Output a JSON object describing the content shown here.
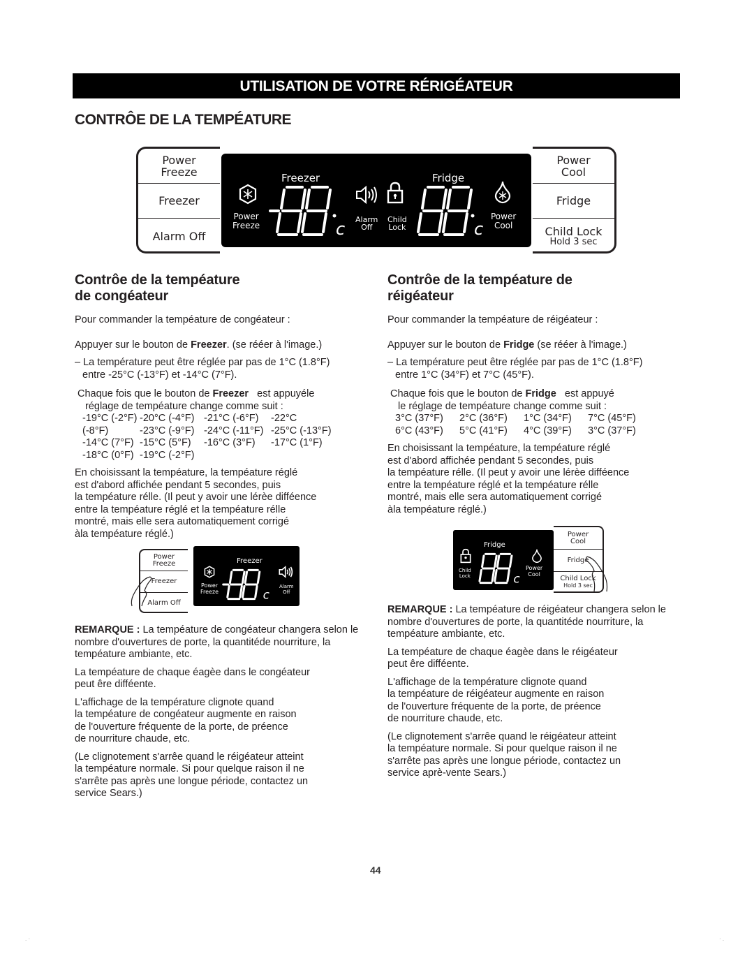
{
  "banner": "UTILISATION DE VOTRE RÉRIGÉATEUR",
  "section_title": "CONTRÔE DE LA TEMPÉATURE",
  "control_panel": {
    "left_buttons": [
      {
        "line1": "Power",
        "line2": "Freeze"
      },
      {
        "line1": "Freezer",
        "line2": ""
      },
      {
        "line1": "Alarm Off",
        "line2": ""
      }
    ],
    "right_buttons": [
      {
        "line1": "Power",
        "line2": "Cool"
      },
      {
        "line1": "Fridge",
        "line2": ""
      },
      {
        "line1": "Child Lock",
        "line2": "Hold 3 sec"
      }
    ],
    "display": {
      "freezer_label": "Freezer",
      "fridge_label": "Fridge",
      "power_freeze_l1": "Power",
      "power_freeze_l2": "Freeze",
      "alarm_off_l1": "Alarm",
      "alarm_off_l2": "Off",
      "child_lock_l1": "Child",
      "child_lock_l2": "Lock",
      "power_cool_l1": "Power",
      "power_cool_l2": "Cool",
      "freezer_readout": "-88",
      "fridge_readout": "88",
      "unit": "c",
      "icons": [
        "snowflake-hexagon-icon",
        "speaker-icon",
        "padlock-icon",
        "droplet-snowflake-icon"
      ]
    }
  },
  "freezer_section": {
    "heading_l1": "Contrôe de la tempéature",
    "heading_l2": "de congéateur",
    "intro": "Pour commander la tempéature de congéateur :",
    "press_pre": "Appuyer sur le bouton de ",
    "press_bold": "Freezer",
    "press_post": ". (se rééer à l'image.)",
    "range_l1": "– La température peut être réglée par pas de 1°C (1.8°F)",
    "range_l2": "entre -25°C (-13°F) et -14°C (7°F).",
    "each_pre": "Chaque fois que le bouton de ",
    "each_bold": "Freezer",
    "each_post": "   est appuyéle",
    "each_l2": "réglage de tempéature change comme suit :",
    "sequence": [
      "-19°C (-2°F)",
      "-20°C (-4°F)",
      "-21°C (-6°F)",
      "-22°C",
      "(-8°F)",
      "-23°C (-9°F)",
      "-24°C (-11°F)",
      "-25°C (-13°F)",
      "-14°C (7°F)",
      "-15°C (5°F)",
      "-16°C (3°F)",
      "-17°C (1°F)",
      "-18°C (0°F)",
      "-19°C (-2°F)"
    ],
    "choose": [
      "En choisissant la tempéature, la tempéature réglé",
      "est d'abord affichée pendant 5 secondes, puis",
      "la tempéature rélle. (Il peut y avoir une lérèe difféence",
      "entre la tempéature réglé et la tempéature rélle",
      "montré, mais elle sera automatiquement corrigé",
      "àla tempéature réglé.)"
    ],
    "figure": {
      "buttons": [
        "Power",
        "Freeze",
        "Freezer",
        "Alarm Off"
      ],
      "disp_label": "Freezer",
      "pf_l1": "Power",
      "pf_l2": "Freeze",
      "ao_l1": "Alarm",
      "ao_l2": "Off",
      "readout": "-88",
      "unit": "c"
    },
    "note_bold": "REMARQUE : ",
    "note": "La tempéature de congéateur changera selon le nombre d'ouvertures de porte, la quantitéde nourriture, la tempéature ambiante, etc.",
    "shelf": [
      "La tempéature de chaque éagèe dans le congéateur",
      "peut êre difféente."
    ],
    "blink": [
      "L'affichage de la température clignote quand",
      "la tempéature de congéateur augmente en raison",
      "de l'ouverture fréquente de la porte, de préence",
      "de nourriture chaude, etc."
    ],
    "stop": [
      "(Le clignotement s'arrêe quand le réigéateur atteint",
      "la tempéature normale. Si pour quelque raison il ne",
      "s'arrête pas après une longue période, contactez un",
      "service Sears.)"
    ]
  },
  "fridge_section": {
    "heading_l1": "Contrôe de la tempéature de",
    "heading_l2": "réigéateur",
    "intro": "Pour commander la tempéature de réigéateur :",
    "press_pre": "Appuyer sur le bouton de ",
    "press_bold": "Fridge",
    "press_post": " (se rééer à l'image.)",
    "range_l1": "– La température peut être réglée par pas de 1°C (1.8°F)",
    "range_l2": "entre 1°C (34°F) et 7°C (45°F).",
    "each_pre": "Chaque fois que le bouton de ",
    "each_bold": "Fridge",
    "each_post": "   est appuyé",
    "each_l2": "le réglage de tempéature change comme suit :",
    "sequence": [
      "3°C (37°F)",
      "2°C (36°F)",
      "1°C (34°F)",
      "7°C (45°F)",
      "6°C (43°F)",
      "5°C (41°F)",
      "4°C (39°F)",
      "3°C (37°F)"
    ],
    "choose": [
      "En choisissant la tempéature, la tempéature réglé",
      "est d'abord affichée pendant 5 secondes, puis",
      "la tempéature rélle. (Il peut y avoir une lérèe difféence",
      "entre la tempéature réglé et la tempéature rélle",
      "montré, mais elle sera automatiquement corrigé",
      "àla tempéature réglé.)"
    ],
    "figure": {
      "buttons": [
        "Power",
        "Cool",
        "Fridge",
        "Child Lock",
        "Hold 3 sec"
      ],
      "disp_label": "Fridge",
      "cl_l1": "Child",
      "cl_l2": "Lock",
      "pc_l1": "Power",
      "pc_l2": "Cool",
      "readout": "88",
      "unit": "c"
    },
    "note_bold": "REMARQUE : ",
    "note": "La tempéature de réigéateur changera selon le nombre d'ouvertures de porte, la quantitéde nourriture, la tempéature ambiante, etc.",
    "shelf": [
      "La tempéature de chaque éagèe dans le réigéateur",
      "peut êre difféente."
    ],
    "blink": [
      "L'affichage de la température clignote quand",
      "la tempéature de réigéateur augmente en raison",
      "de l'ouverture fréquente de la porte, de préence",
      "de nourriture chaude, etc."
    ],
    "stop": [
      "(Le clignotement s'arrêe quand le réigéateur atteint",
      "la tempéature normale. Si pour quelque raison il ne",
      "s'arrête pas après une longue période, contactez un",
      "service aprè-vente Sears.)"
    ]
  },
  "page_number": "44"
}
